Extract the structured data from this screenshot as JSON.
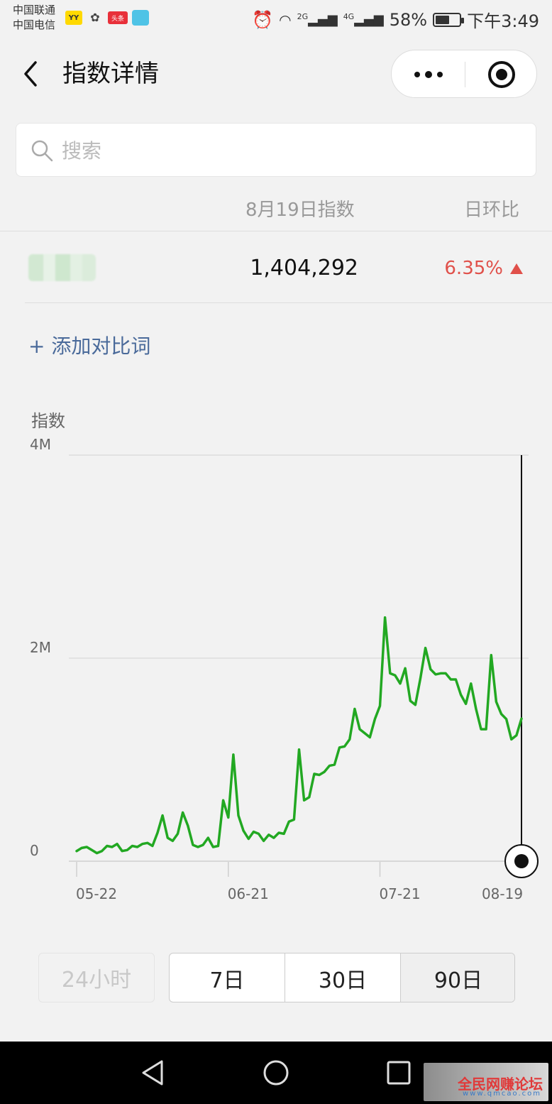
{
  "status_bar": {
    "carrier1": "中国联通",
    "carrier2": "中国电信",
    "yy_icon": "YY",
    "toutiao_icon": "头条",
    "signal_2g": "2G",
    "signal_4g": "4G",
    "battery": "58%",
    "battery_level": 0.58,
    "time": "下午3:49"
  },
  "nav": {
    "title": "指数详情"
  },
  "search": {
    "placeholder": "搜索"
  },
  "table": {
    "col_date": "8月19日指数",
    "col_change": "日环比",
    "row_value": "1,404,292",
    "row_change": "6.35%",
    "change_color": "#e0504a"
  },
  "add_compare": "+ 添加对比词",
  "chart_data": {
    "type": "line",
    "ylabel": "指数",
    "y_ticks": [
      "4M",
      "2M",
      "0"
    ],
    "ylim": [
      0,
      4000000
    ],
    "x_ticks": [
      "05-22",
      "06-21",
      "07-21",
      "08-19"
    ],
    "line_color": "#22a822",
    "series": [
      {
        "values": [
          100000,
          130000,
          140000,
          110000,
          80000,
          100000,
          150000,
          140000,
          170000,
          100000,
          110000,
          150000,
          140000,
          170000,
          180000,
          150000,
          280000,
          450000,
          230000,
          200000,
          270000,
          480000,
          350000,
          160000,
          140000,
          160000,
          230000,
          140000,
          150000,
          600000,
          430000,
          1050000,
          450000,
          300000,
          220000,
          290000,
          270000,
          200000,
          260000,
          230000,
          280000,
          270000,
          390000,
          410000,
          1100000,
          600000,
          630000,
          860000,
          850000,
          880000,
          940000,
          950000,
          1120000,
          1130000,
          1200000,
          1500000,
          1300000,
          1260000,
          1220000,
          1400000,
          1530000,
          2400000,
          1850000,
          1830000,
          1750000,
          1900000,
          1580000,
          1540000,
          1800000,
          2100000,
          1890000,
          1840000,
          1850000,
          1850000,
          1790000,
          1790000,
          1640000,
          1550000,
          1750000,
          1500000,
          1300000,
          1300000,
          2030000,
          1570000,
          1450000,
          1400000,
          1200000,
          1240000,
          1404292
        ]
      }
    ]
  },
  "ranges": {
    "r24": "24小时",
    "r7": "7日",
    "r30": "30日",
    "r90": "90日",
    "selected": "90日"
  },
  "watermark": {
    "text": "全民网赚论坛",
    "sub": "www.qmcao.com"
  }
}
